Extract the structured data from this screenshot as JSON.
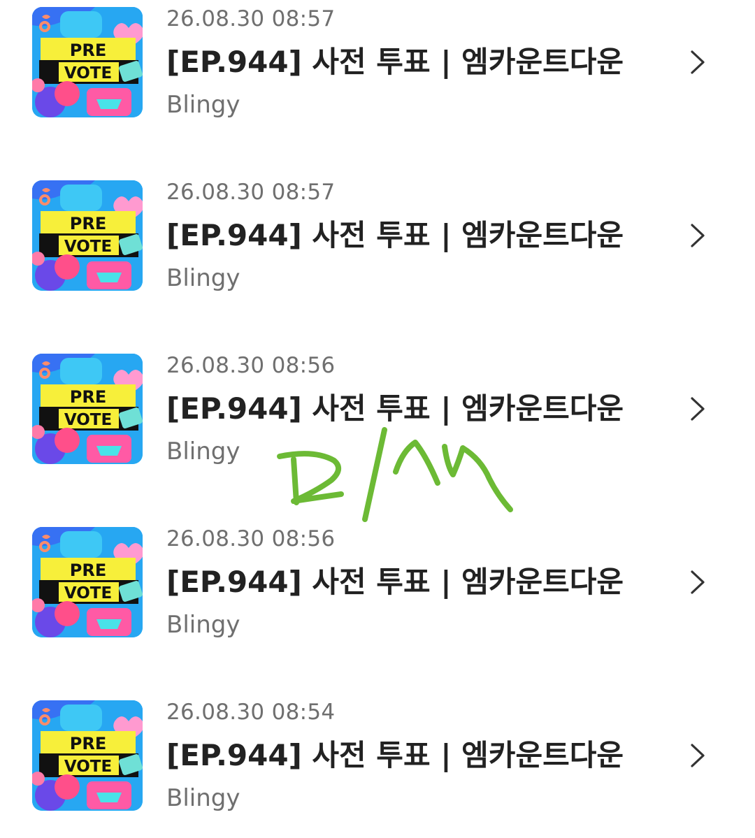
{
  "items": [
    {
      "timestamp": "26.08.30 08:57",
      "title": "[EP.944] 사전 투표 | 엠카운트다운",
      "author": "Blingy",
      "thumb": {
        "line1": "PRE",
        "line2": "VOTE"
      }
    },
    {
      "timestamp": "26.08.30 08:57",
      "title": "[EP.944] 사전 투표 | 엠카운트다운",
      "author": "Blingy",
      "thumb": {
        "line1": "PRE",
        "line2": "VOTE"
      }
    },
    {
      "timestamp": "26.08.30 08:56",
      "title": "[EP.944] 사전 투표 | 엠카운트다운",
      "author": "Blingy",
      "thumb": {
        "line1": "PRE",
        "line2": "VOTE"
      }
    },
    {
      "timestamp": "26.08.30 08:56",
      "title": "[EP.944] 사전 투표 | 엠카운트다운",
      "author": "Blingy",
      "thumb": {
        "line1": "PRE",
        "line2": "VOTE"
      }
    },
    {
      "timestamp": "26.08.30 08:54",
      "title": "[EP.944] 사전 투표 | 엠카운트다운",
      "author": "Blingy",
      "thumb": {
        "line1": "PRE",
        "line2": "VOTE"
      }
    }
  ],
  "icons": {
    "row_chevron": "chevron-right-icon"
  },
  "colors": {
    "title": "#222222",
    "meta": "#6f6f6f",
    "chevron": "#333333",
    "banner_yellow": "#f7ef3a",
    "banner_black": "#111111",
    "heart_pink": "#ff8fc8",
    "handwriting_green": "#6cba35"
  },
  "annotation": {
    "text": "DKU"
  }
}
